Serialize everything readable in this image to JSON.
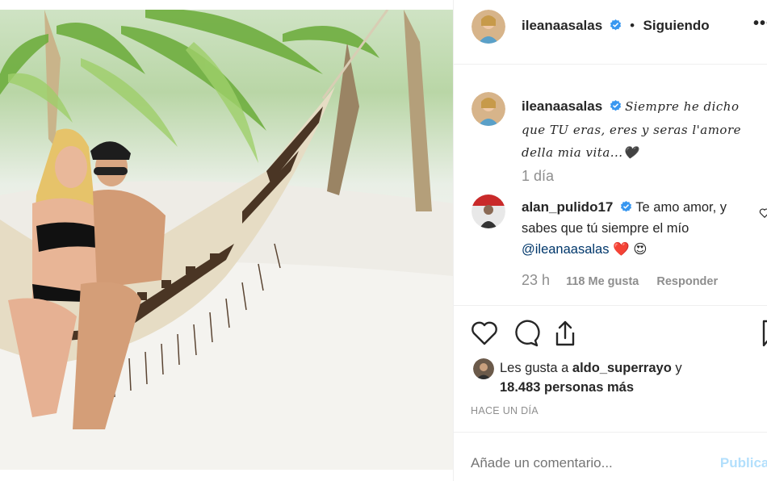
{
  "header": {
    "username": "ileanaasalas",
    "separator": "•",
    "follow_status": "Siguiendo",
    "more": "•••"
  },
  "caption": {
    "username": "ileanaasalas",
    "line1": "Siempre he dicho",
    "line2": "que TU eras, eres y seras l'amore",
    "line3": "della mia vita...🖤",
    "time": "1 día"
  },
  "comment": {
    "username": "alan_pulido17",
    "text1": "Te amo amor, y",
    "text2": "sabes que tú siempre el mío",
    "mention": "@ileanaasalas",
    "emojis": "❤️ 😍",
    "time": "23 h",
    "likes": "118 Me gusta",
    "reply": "Responder"
  },
  "likes": {
    "prefix": "Les gusta a",
    "user": "aldo_superrayo",
    "conj": "y",
    "count": "18.483 personas más"
  },
  "post_time": "HACE UN DÍA",
  "composer": {
    "placeholder": "Añade un comentario...",
    "publish": "Publicar"
  },
  "colors": {
    "verified": "#3897f0",
    "link": "#00376b",
    "muted": "#8e8e8e"
  }
}
